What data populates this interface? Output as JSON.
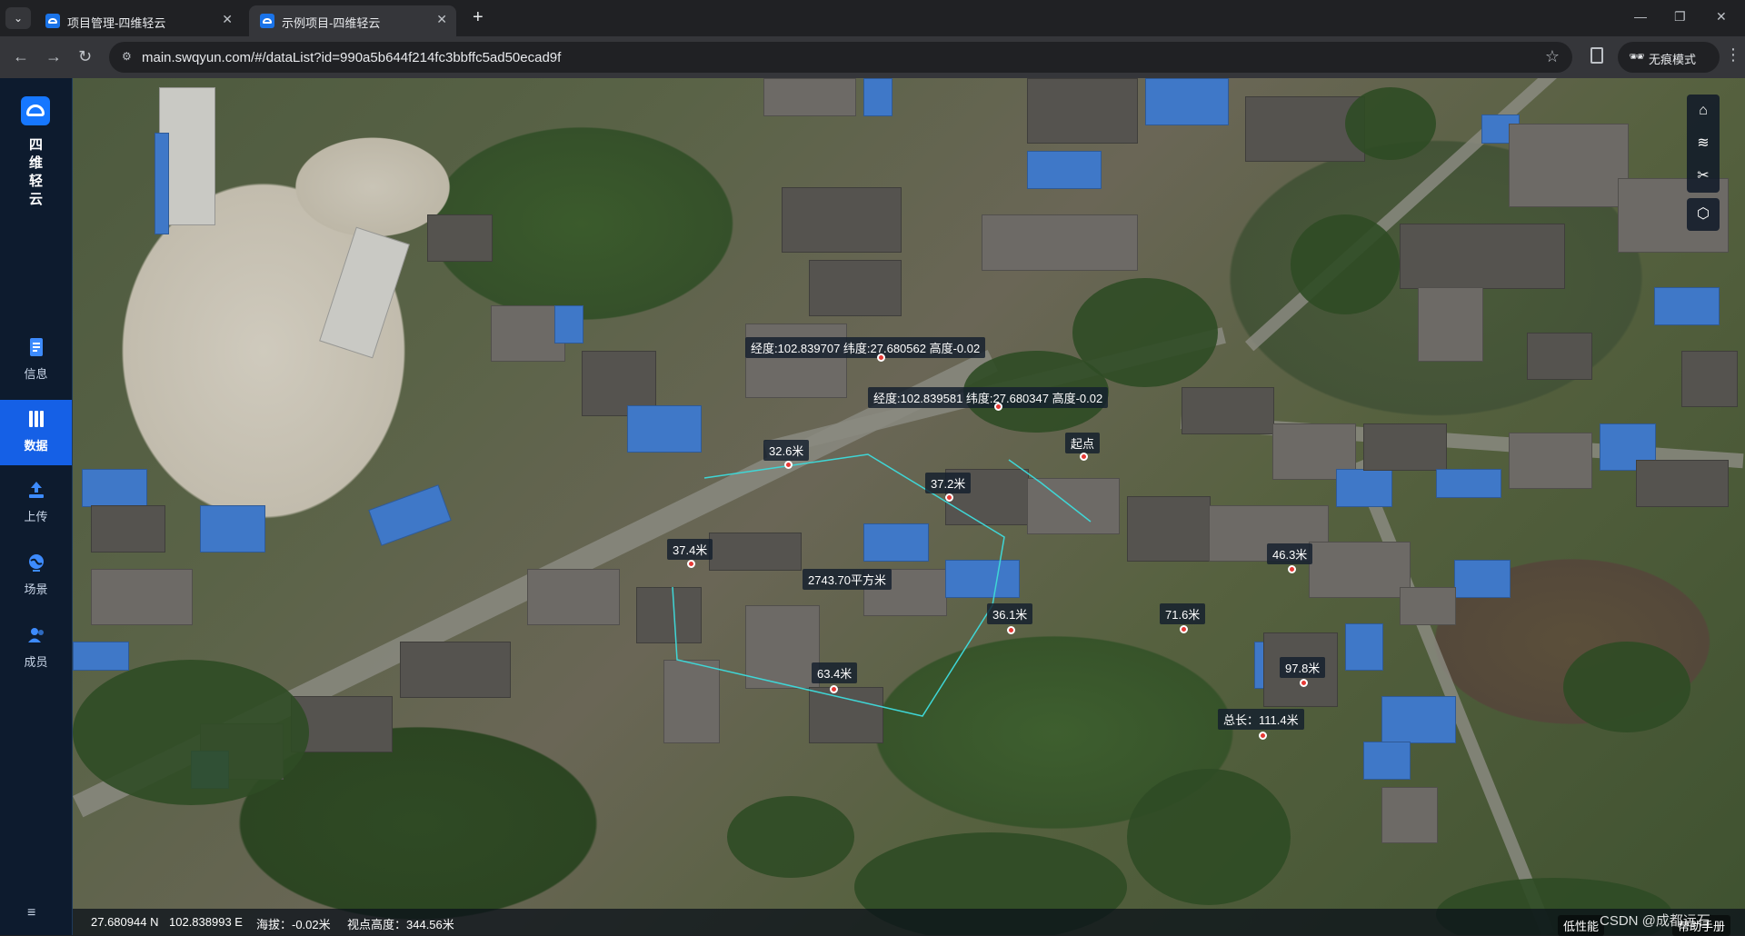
{
  "browser": {
    "tabs": [
      {
        "title": "项目管理-四维轻云",
        "close": "✕"
      },
      {
        "title": "示例项目-四维轻云",
        "close": "✕"
      }
    ],
    "new_tab": "+",
    "url": "main.swqyun.com/#/dataList?id=990a5b644f214fc3bbffc5ad50ecad9f",
    "incognito_label": "无痕模式",
    "window_controls": {
      "minimize": "—",
      "restore": "❐",
      "close": "✕"
    },
    "icons": {
      "back": "←",
      "forward": "→",
      "reload": "↻",
      "star": "☆",
      "menu": "⋮",
      "tab_search": "⌄",
      "site_info": "⚙",
      "incognito": "🕶"
    }
  },
  "app": {
    "brand": "四维轻云",
    "nav": [
      {
        "label": "信息",
        "icon": "document-icon",
        "active": false
      },
      {
        "label": "数据",
        "icon": "database-icon",
        "active": true
      },
      {
        "label": "上传",
        "icon": "upload-icon",
        "active": false
      },
      {
        "label": "场景",
        "icon": "globe-icon",
        "active": false
      },
      {
        "label": "成员",
        "icon": "users-icon",
        "active": false
      }
    ],
    "collapse_icon": "≡"
  },
  "map": {
    "labels": {
      "coord1": "经度:102.839707 纬度:27.680562 高度-0.02",
      "coord2": "经度:102.839581 纬度:27.680347 高度-0.02",
      "start": "起点",
      "seg_32_6": "32.6米",
      "seg_37_2": "37.2米",
      "seg_37_4": "37.4米",
      "area": "2743.70平方米",
      "seg_36_1": "36.1米",
      "seg_63_4": "63.4米",
      "seg_46_3": "46.3米",
      "seg_71_6": "71.6米",
      "seg_97_8": "97.8米",
      "total": "总长：111.4米"
    },
    "tools": [
      {
        "name": "home-icon",
        "glyph": "⌂"
      },
      {
        "name": "layers-icon",
        "glyph": "≋"
      },
      {
        "name": "measure-tools-icon",
        "glyph": "✂"
      },
      {
        "name": "cube-icon",
        "glyph": "⬡"
      }
    ],
    "colors": {
      "measure_line": "#3fd6d6",
      "point": "#e53935",
      "active_nav": "#1560e6"
    }
  },
  "status": {
    "lat": "27.680944 N",
    "lon": "102.838993 E",
    "altitude": "海拔：-0.02米",
    "view_height": "视点高度：344.56米",
    "performance": "低性能",
    "help": "帮助手册",
    "watermark": "CSDN @成都远石"
  }
}
